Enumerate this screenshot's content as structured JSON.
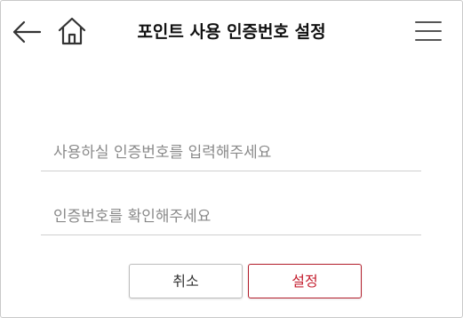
{
  "header": {
    "title": "포인트 사용 인증번호 설정",
    "back_icon": "arrow-left-icon",
    "home_icon": "home-icon",
    "menu_icon": "hamburger-menu-icon"
  },
  "form": {
    "code_input": {
      "value": "",
      "placeholder": "사용하실 인증번호를 입력해주세요"
    },
    "confirm_input": {
      "value": "",
      "placeholder": "인증번호를 확인해주세요"
    }
  },
  "actions": {
    "cancel_label": "취소",
    "confirm_label": "설정"
  },
  "colors": {
    "accent": "#c41e2e",
    "text": "#222222",
    "placeholder": "#8a8a8a",
    "divider": "#cfcfcf"
  }
}
